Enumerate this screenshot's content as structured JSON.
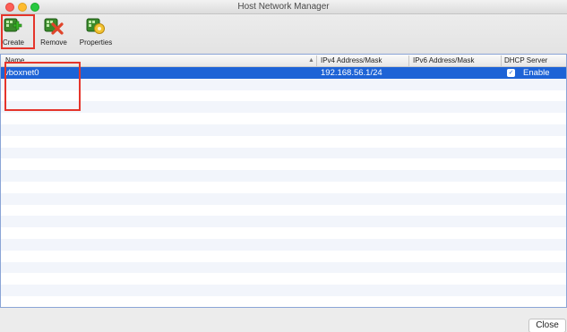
{
  "window": {
    "title": "Host Network Manager"
  },
  "toolbar": {
    "create_label": "Create",
    "remove_label": "Remove",
    "properties_label": "Properties"
  },
  "table": {
    "columns": [
      "Name",
      "IPv4 Address/Mask",
      "IPv6 Address/Mask",
      "DHCP Server"
    ],
    "sort_indicator": "▲",
    "rows": [
      {
        "name": "vboxnet0",
        "ipv4": "192.168.56.1/24",
        "ipv6": "",
        "dhcp_enabled": true,
        "dhcp_label": "Enable"
      }
    ]
  },
  "footer": {
    "close_label": "Close"
  },
  "colors": {
    "selection": "#1d63d6",
    "annotation": "#e5352b",
    "alt_row": "#f2f5fb"
  }
}
